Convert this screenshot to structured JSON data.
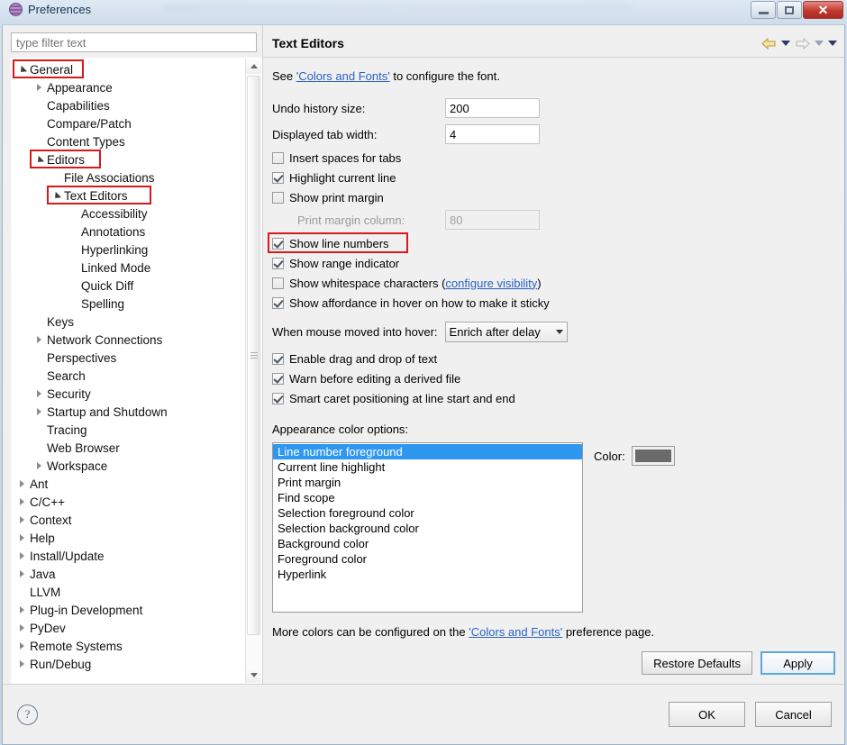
{
  "window": {
    "title": "Preferences",
    "app_icon": "eclipse-sphere-icon",
    "minimize_label": "",
    "maximize_label": "",
    "close_label": "✕"
  },
  "sidebar": {
    "filter_placeholder": "type filter text",
    "filter_value": "",
    "tree": [
      {
        "label": "General",
        "indent": 0,
        "twisty": "open",
        "highlight": true
      },
      {
        "label": "Appearance",
        "indent": 1,
        "twisty": "closed",
        "highlight": false
      },
      {
        "label": "Capabilities",
        "indent": 1,
        "twisty": "none",
        "highlight": false
      },
      {
        "label": "Compare/Patch",
        "indent": 1,
        "twisty": "none",
        "highlight": false
      },
      {
        "label": "Content Types",
        "indent": 1,
        "twisty": "none",
        "highlight": false
      },
      {
        "label": "Editors",
        "indent": 1,
        "twisty": "open",
        "highlight": true
      },
      {
        "label": "File Associations",
        "indent": 2,
        "twisty": "none",
        "highlight": false
      },
      {
        "label": "Text Editors",
        "indent": 2,
        "twisty": "open",
        "highlight": true
      },
      {
        "label": "Accessibility",
        "indent": 3,
        "twisty": "none",
        "highlight": false
      },
      {
        "label": "Annotations",
        "indent": 3,
        "twisty": "none",
        "highlight": false
      },
      {
        "label": "Hyperlinking",
        "indent": 3,
        "twisty": "none",
        "highlight": false
      },
      {
        "label": "Linked Mode",
        "indent": 3,
        "twisty": "none",
        "highlight": false
      },
      {
        "label": "Quick Diff",
        "indent": 3,
        "twisty": "none",
        "highlight": false
      },
      {
        "label": "Spelling",
        "indent": 3,
        "twisty": "none",
        "highlight": false
      },
      {
        "label": "Keys",
        "indent": 1,
        "twisty": "none",
        "highlight": false
      },
      {
        "label": "Network Connections",
        "indent": 1,
        "twisty": "closed",
        "highlight": false
      },
      {
        "label": "Perspectives",
        "indent": 1,
        "twisty": "none",
        "highlight": false
      },
      {
        "label": "Search",
        "indent": 1,
        "twisty": "none",
        "highlight": false
      },
      {
        "label": "Security",
        "indent": 1,
        "twisty": "closed",
        "highlight": false
      },
      {
        "label": "Startup and Shutdown",
        "indent": 1,
        "twisty": "closed",
        "highlight": false
      },
      {
        "label": "Tracing",
        "indent": 1,
        "twisty": "none",
        "highlight": false
      },
      {
        "label": "Web Browser",
        "indent": 1,
        "twisty": "none",
        "highlight": false
      },
      {
        "label": "Workspace",
        "indent": 1,
        "twisty": "closed",
        "highlight": false
      },
      {
        "label": "Ant",
        "indent": 0,
        "twisty": "closed",
        "highlight": false
      },
      {
        "label": "C/C++",
        "indent": 0,
        "twisty": "closed",
        "highlight": false
      },
      {
        "label": "Context",
        "indent": 0,
        "twisty": "closed",
        "highlight": false
      },
      {
        "label": "Help",
        "indent": 0,
        "twisty": "closed",
        "highlight": false
      },
      {
        "label": "Install/Update",
        "indent": 0,
        "twisty": "closed",
        "highlight": false
      },
      {
        "label": "Java",
        "indent": 0,
        "twisty": "closed",
        "highlight": false
      },
      {
        "label": "LLVM",
        "indent": 0,
        "twisty": "none",
        "highlight": false
      },
      {
        "label": "Plug-in Development",
        "indent": 0,
        "twisty": "closed",
        "highlight": false
      },
      {
        "label": "PyDev",
        "indent": 0,
        "twisty": "closed",
        "highlight": false
      },
      {
        "label": "Remote Systems",
        "indent": 0,
        "twisty": "closed",
        "highlight": false
      },
      {
        "label": "Run/Debug",
        "indent": 0,
        "twisty": "closed",
        "highlight": false
      }
    ]
  },
  "page": {
    "title": "Text Editors",
    "nav": {
      "back_icon": "back-arrow-icon",
      "back_dropdown_icon": "chevron-down-icon",
      "forward_icon": "forward-arrow-icon",
      "forward_dropdown_icon": "chevron-down-icon",
      "menu_icon": "chevron-down-icon"
    },
    "intro": {
      "prefix": "See ",
      "link": "'Colors and Fonts'",
      "suffix": " to configure the font."
    },
    "fields": [
      {
        "label": "Undo history size:",
        "value": "200",
        "disabled": false
      },
      {
        "label": "Displayed tab width:",
        "value": "4",
        "disabled": false
      }
    ],
    "print_margin_field": {
      "label": "Print margin column:",
      "value": "80",
      "disabled": true
    },
    "checkboxes_top": [
      {
        "label": "Insert spaces for tabs",
        "checked": false,
        "highlight": false
      },
      {
        "label": "Highlight current line",
        "checked": true,
        "highlight": false
      },
      {
        "label": "Show print margin",
        "checked": false,
        "highlight": false
      }
    ],
    "checkboxes_mid": [
      {
        "label": "Show line numbers",
        "checked": true,
        "highlight": true
      },
      {
        "label": "Show range indicator",
        "checked": true,
        "highlight": false
      }
    ],
    "whitespace_row": {
      "checked": false,
      "prefix": "Show whitespace characters (",
      "link": "configure visibility",
      "suffix": ")"
    },
    "affordance_row": {
      "checked": true,
      "label": "Show affordance in hover on how to make it sticky"
    },
    "hover": {
      "label": "When mouse moved into hover:",
      "value": "Enrich after delay",
      "dropdown_icon": "chevron-down-icon"
    },
    "checkboxes_bottom": [
      {
        "label": "Enable drag and drop of text",
        "checked": true
      },
      {
        "label": "Warn before editing a derived file",
        "checked": true
      },
      {
        "label": "Smart caret positioning at line start and end",
        "checked": true
      }
    ],
    "appearance_section_label": "Appearance color options:",
    "color_options": [
      {
        "label": "Line number foreground",
        "selected": true
      },
      {
        "label": "Current line highlight",
        "selected": false
      },
      {
        "label": "Print margin",
        "selected": false
      },
      {
        "label": "Find scope",
        "selected": false
      },
      {
        "label": "Selection foreground color",
        "selected": false
      },
      {
        "label": "Selection background color",
        "selected": false
      },
      {
        "label": "Background color",
        "selected": false
      },
      {
        "label": "Foreground color",
        "selected": false
      },
      {
        "label": "Hyperlink",
        "selected": false
      }
    ],
    "color_picker": {
      "label": "Color:",
      "swatch_hex": "#6a6a6a"
    },
    "more_colors": {
      "prefix": "More colors can be configured on the ",
      "link": "'Colors and Fonts'",
      "suffix": " preference page."
    },
    "buttons": {
      "restore_defaults": "Restore Defaults",
      "apply": "Apply"
    }
  },
  "footer": {
    "help_icon": "question-mark-icon",
    "ok": "OK",
    "cancel": "Cancel"
  },
  "theme": {
    "accent": "#2e97f0",
    "highlight_box": "#d7191c",
    "link": "#2a62c4",
    "dialog_bg": "#f0f0f0"
  }
}
